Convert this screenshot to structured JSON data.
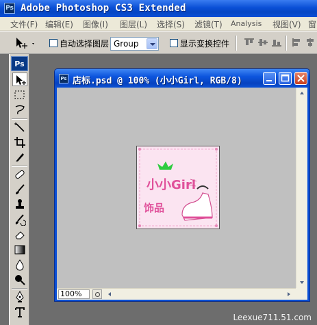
{
  "app": {
    "logo_text": "Ps",
    "title": "Adobe Photoshop CS3 Extended"
  },
  "menu": [
    {
      "name": "file",
      "label": "文件(F)"
    },
    {
      "name": "edit",
      "label": "编辑(E)"
    },
    {
      "name": "image",
      "label": "图像(I)"
    },
    {
      "name": "layer",
      "label": "图层(L)"
    },
    {
      "name": "select",
      "label": "选择(S)"
    },
    {
      "name": "filter",
      "label": "滤镜(T)"
    },
    {
      "name": "analysis",
      "label": "Analysis"
    },
    {
      "name": "view",
      "label": "视图(V)"
    },
    {
      "name": "window",
      "label": "窗"
    }
  ],
  "options": {
    "auto_select_label": "自动选择图层",
    "auto_select_checked": false,
    "group_select_value": "Group",
    "transform_controls_label": "显示变换控件",
    "transform_controls_checked": false
  },
  "toolbox": {
    "logo_text": "Ps",
    "tools": [
      {
        "name": "move-tool",
        "icon": "move-icon",
        "active": true
      },
      {
        "name": "marquee-tool",
        "icon": "marquee-icon"
      },
      {
        "name": "lasso-tool",
        "icon": "lasso-icon"
      },
      {
        "name": "magic-wand-tool",
        "icon": "magic-wand-icon"
      },
      {
        "name": "crop-tool",
        "icon": "crop-icon"
      },
      {
        "name": "slice-tool",
        "icon": "slice-icon"
      },
      {
        "name": "healing-brush-tool",
        "icon": "bandage-icon"
      },
      {
        "name": "brush-tool",
        "icon": "brush-icon"
      },
      {
        "name": "clone-stamp-tool",
        "icon": "stamp-icon"
      },
      {
        "name": "history-brush-tool",
        "icon": "history-brush-icon"
      },
      {
        "name": "eraser-tool",
        "icon": "eraser-icon"
      },
      {
        "name": "gradient-tool",
        "icon": "gradient-icon"
      },
      {
        "name": "blur-tool",
        "icon": "drop-icon"
      },
      {
        "name": "dodge-tool",
        "icon": "dodge-icon"
      },
      {
        "name": "pen-tool",
        "icon": "pen-icon"
      },
      {
        "name": "type-tool",
        "icon": "type-icon"
      }
    ]
  },
  "document": {
    "title": "店标.psd @ 100% (小小Girl, RGB/8)",
    "icon_text": "Ps",
    "zoom": "100%",
    "canvas": {
      "headline": "小小Girl",
      "subtitle": "饰品",
      "crown_color": "#2ecc40",
      "text_color": "#e0509a",
      "background_color": "#fbe4f1"
    }
  },
  "watermark": "Leexue711.51.com",
  "colors": {
    "titlebar_blue": "#0a4fd6",
    "menubar": "#ece9d8",
    "toolbar_gray": "#d4d0c8",
    "workspace": "#6d6d6d"
  }
}
